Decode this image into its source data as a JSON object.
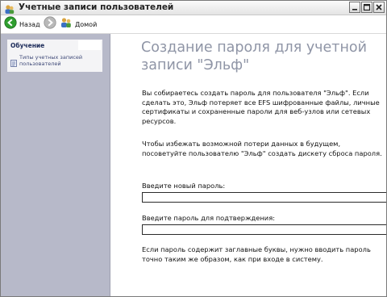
{
  "window": {
    "title": "Учетные записи пользователей"
  },
  "toolbar": {
    "back_label": "Назад",
    "home_label": "Домой"
  },
  "sidebar": {
    "panel_title": "Обучение",
    "items": [
      {
        "label": "Типы учетных записей пользователей"
      }
    ]
  },
  "main": {
    "heading": "Создание пароля для учетной записи \"Эльф\"",
    "paragraph_1": "Вы собираетесь создать пароль для пользователя \"Эльф\". Если сделать это, Эльф потеряет все EFS шифрованные файлы, личные сертификаты и сохраненные пароли для веб-узлов или сетевых ресурсов.",
    "paragraph_2": "Чтобы избежать возможной потери данных в будущем, посоветуйте пользователю \"Эльф\" создать дискету сброса пароля.",
    "password_label": "Введите новый пароль:",
    "password_value": "",
    "confirm_label": "Введите пароль для подтверждения:",
    "confirm_value": "",
    "paragraph_3": "Если пароль содержит заглавные буквы, нужно вводить пароль точно таким же образом, как при входе в систему."
  },
  "colors": {
    "sidebar_bg": "#b7b9c9",
    "heading": "#8f95a6",
    "back_arrow": "#2f9e2f"
  }
}
